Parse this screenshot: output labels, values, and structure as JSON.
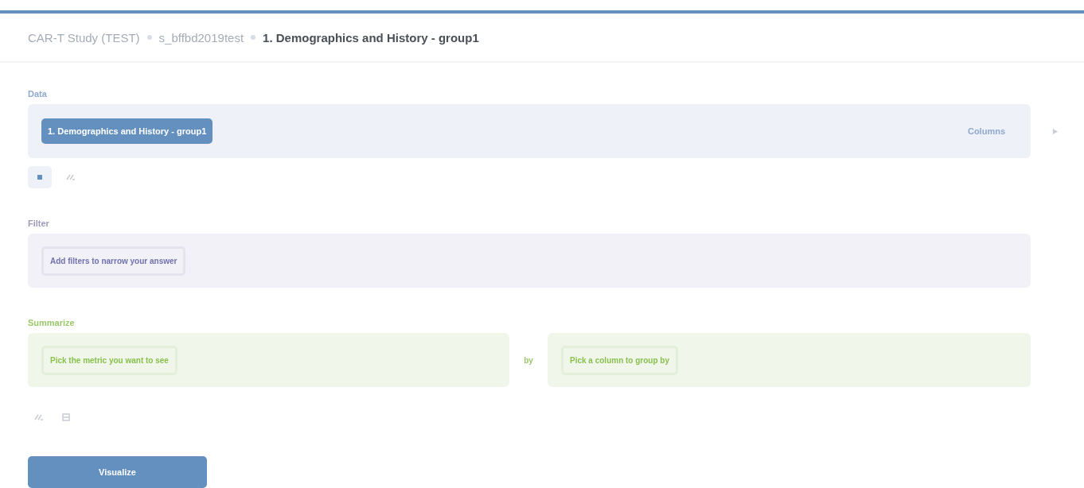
{
  "breadcrumb": [
    {
      "label": "CAR-T Study (TEST)",
      "current": false
    },
    {
      "label": "s_bffbd2019test",
      "current": false
    },
    {
      "label": "1. Demographics and History - group1",
      "current": true
    }
  ],
  "data": {
    "label": "Data",
    "table": "1. Demographics and History - group1",
    "columns_link": "Columns"
  },
  "filter": {
    "label": "Filter",
    "placeholder": "Add filters to narrow your answer"
  },
  "summarize": {
    "label": "Summarize",
    "metric_placeholder": "Pick the metric you want to see",
    "by": "by",
    "group_placeholder": "Pick a column to group by"
  },
  "visualize_button": "Visualize"
}
